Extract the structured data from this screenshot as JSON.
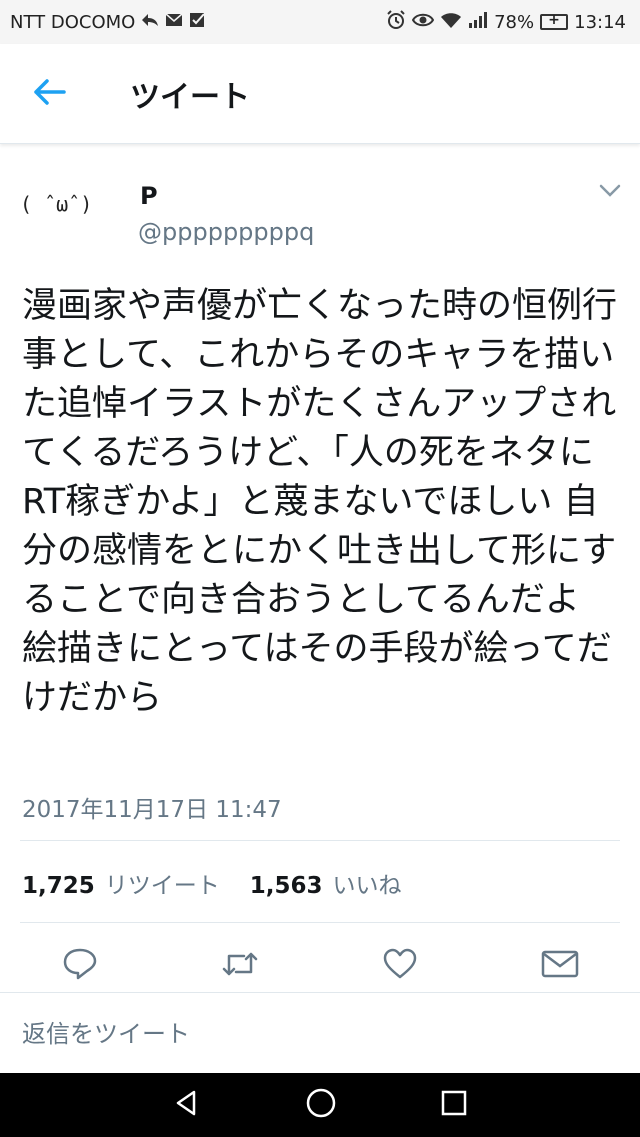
{
  "status_bar": {
    "carrier": "NTT DOCOMO",
    "battery": "78%",
    "time": "13:14",
    "icons": [
      "reply-arrow-icon",
      "mail-icon",
      "check-icon",
      "alarm-icon",
      "eye-icon",
      "wifi-icon",
      "signal-icon",
      "battery-icon"
    ]
  },
  "header": {
    "back_icon": "back-arrow-icon",
    "title": "ツイート"
  },
  "tweet": {
    "avatar_text": "( ˆωˆ)",
    "name": "P",
    "handle": "@pppppppppq",
    "text": "漫画家や声優が亡くなった時の恒例行事として、これからそのキャラを描いた追悼イラストがたくさんアップされてくるだろうけど、「人の死をネタにRT稼ぎかよ」と蔑まないでほしい 自分の感情をとにかく吐き出して形にすることで向き合おうとしてるんだよ 絵描きにとってはその手段が絵ってだけだから",
    "timestamp": "2017年11月17日 11:47",
    "retweets_count": "1,725",
    "retweets_label": "リツイート",
    "likes_count": "1,563",
    "likes_label": "いいね"
  },
  "actions": [
    "reply-icon",
    "retweet-icon",
    "like-icon",
    "message-icon"
  ],
  "reply_placeholder": "返信をツイート",
  "colors": {
    "accent": "#1da1f2",
    "text": "#14171a",
    "secondary": "#657786",
    "divider": "#e1e8ed"
  },
  "nav": [
    "back-triangle-icon",
    "home-circle-icon",
    "recents-square-icon"
  ]
}
